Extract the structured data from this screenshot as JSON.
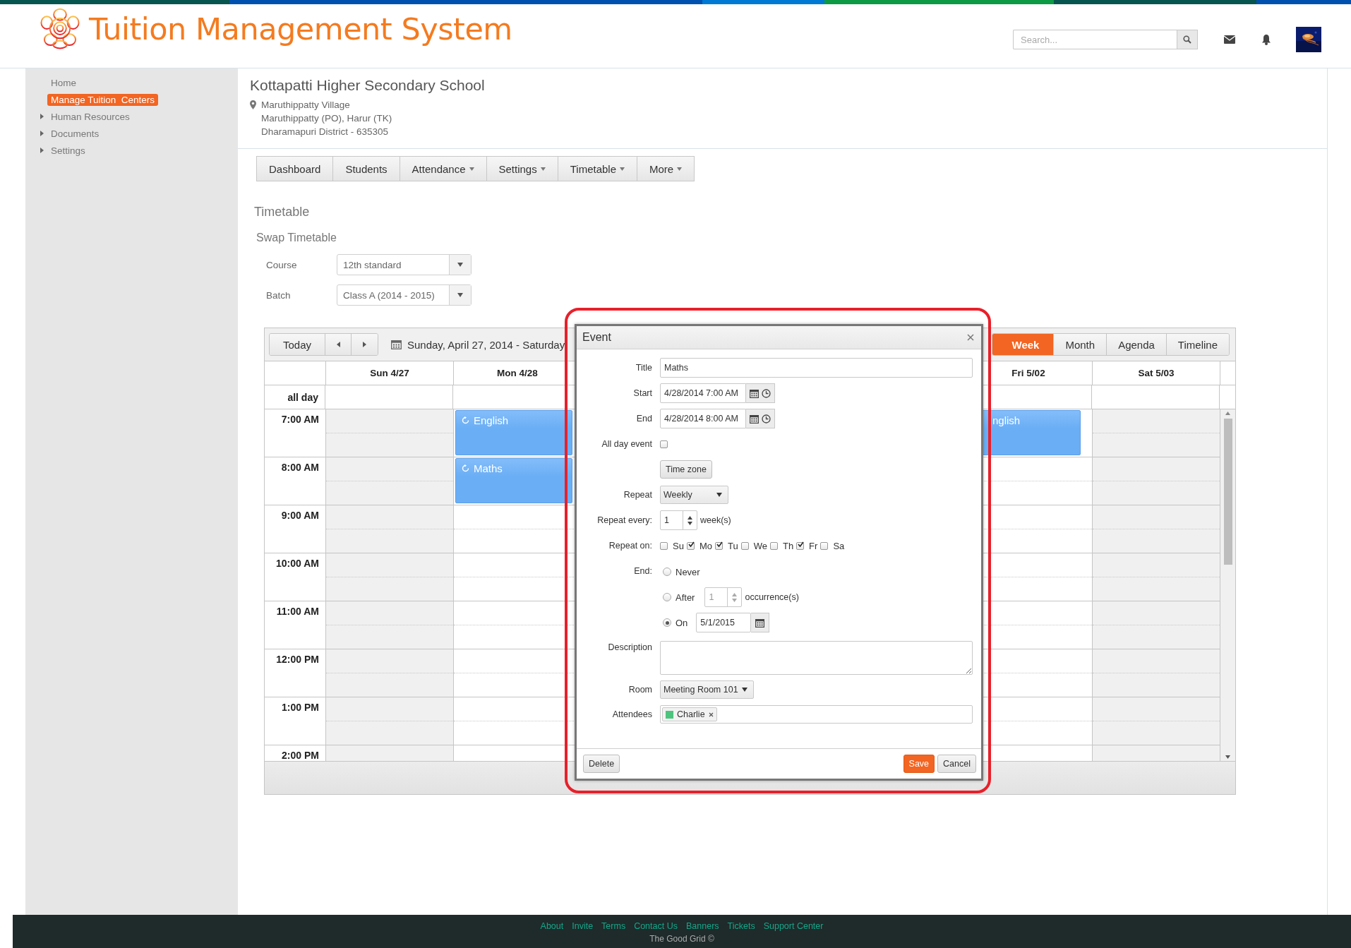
{
  "header": {
    "title": "Tuition Management System",
    "search": {
      "placeholder": "Search..."
    }
  },
  "sidebar": {
    "items": [
      {
        "label": "Home",
        "selected": false,
        "expandable": false
      },
      {
        "label": "Manage Tuition  Centers",
        "selected": true,
        "expandable": false
      },
      {
        "label": "Human Resources",
        "selected": false,
        "expandable": true
      },
      {
        "label": "Documents",
        "selected": false,
        "expandable": true
      },
      {
        "label": "Settings",
        "selected": false,
        "expandable": true
      }
    ]
  },
  "school": {
    "name": "Kottapatti Higher Secondary School",
    "address": [
      "Maruthippatty Village",
      "Maruthippatty (PO), Harur (TK)",
      "Dharamapuri District - 635305"
    ]
  },
  "nav_tabs": [
    {
      "label": "Dashboard",
      "dropdown": false
    },
    {
      "label": "Students",
      "dropdown": false
    },
    {
      "label": "Attendance",
      "dropdown": true
    },
    {
      "label": "Settings",
      "dropdown": true
    },
    {
      "label": "Timetable",
      "dropdown": true
    },
    {
      "label": "More",
      "dropdown": true
    }
  ],
  "section_title": "Timetable",
  "subsection_title": "Swap Timetable",
  "filters": [
    {
      "label": "Course",
      "value": "12th standard"
    },
    {
      "label": "Batch",
      "value": "Class A (2014 - 2015)"
    }
  ],
  "scheduler": {
    "today": "Today",
    "range": "Sunday, April 27, 2014 - Saturday",
    "views": [
      {
        "label": "Week",
        "selected": true
      },
      {
        "label": "Month",
        "selected": false
      },
      {
        "label": "Agenda",
        "selected": false
      },
      {
        "label": "Timeline",
        "selected": false
      }
    ],
    "all_day": "all day",
    "times": [
      "7:00 AM",
      "8:00 AM",
      "9:00 AM",
      "10:00 AM",
      "11:00 AM",
      "12:00 PM",
      "1:00 PM",
      "2:00 PM"
    ],
    "days_left": [
      {
        "label": "Sun 4/27",
        "weekend": true
      },
      {
        "label": "Mon 4/28",
        "weekend": false,
        "events": [
          {
            "title": "English",
            "recurring": true
          },
          {
            "title": "Maths",
            "recurring": true
          }
        ]
      }
    ],
    "days_right": [
      {
        "label": "Fri 5/02",
        "weekend": false,
        "events": [
          {
            "title": "nglish"
          }
        ]
      },
      {
        "label": "Sat 5/03",
        "weekend": true
      }
    ]
  },
  "dialog": {
    "title": "Event",
    "title_field": {
      "label": "Title",
      "value": "Maths"
    },
    "start": {
      "label": "Start",
      "value": "4/28/2014 7:00 AM"
    },
    "end": {
      "label": "End",
      "value": "4/28/2014 8:00 AM"
    },
    "all_day": {
      "label": "All day event",
      "checked": false
    },
    "timezone_button": "Time zone",
    "repeat": {
      "label": "Repeat",
      "value": "Weekly"
    },
    "repeat_every": {
      "label": "Repeat every:",
      "value": "1",
      "unit": "week(s)"
    },
    "repeat_on": {
      "label": "Repeat on:",
      "days": [
        {
          "label": "Su",
          "checked": false
        },
        {
          "label": "Mo",
          "checked": true
        },
        {
          "label": "Tu",
          "checked": true
        },
        {
          "label": "We",
          "checked": false
        },
        {
          "label": "Th",
          "checked": false
        },
        {
          "label": "Fr",
          "checked": true
        },
        {
          "label": "Sa",
          "checked": false
        }
      ]
    },
    "end_rule": {
      "label": "End:",
      "options": [
        {
          "kind": "never",
          "label": "Never",
          "selected": false
        },
        {
          "kind": "after",
          "label": "After",
          "selected": false,
          "value": "1",
          "unit": "occurrence(s)",
          "disabled": true
        },
        {
          "kind": "on",
          "label": "On",
          "selected": true,
          "value": "5/1/2015"
        }
      ]
    },
    "description": {
      "label": "Description"
    },
    "room": {
      "label": "Room",
      "value": "Meeting Room 101"
    },
    "attendees": {
      "label": "Attendees",
      "tags": [
        {
          "label": "Charlie",
          "color": "#4cc47e"
        }
      ]
    },
    "buttons": {
      "delete": "Delete",
      "save": "Save",
      "cancel": "Cancel"
    }
  },
  "footer": {
    "links": [
      "About",
      "Invite",
      "Terms",
      "Contact Us",
      "Banners",
      "Tickets",
      "Support Center"
    ],
    "copyright": "The Good Grid ©"
  }
}
